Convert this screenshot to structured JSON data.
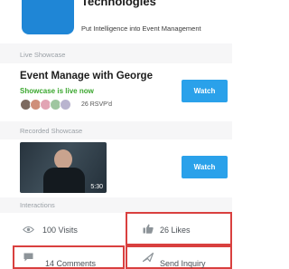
{
  "header": {
    "company_name": "Technologies",
    "tagline": "Put Intelligence into Event Management"
  },
  "live_showcase": {
    "label": "Live Showcase",
    "title": "Event Manage with George",
    "status": "Showcase is live now",
    "rsvp": "26 RSVP'd",
    "watch_label": "Watch"
  },
  "recorded_showcase": {
    "label": "Recorded Showcase",
    "duration": "5:30",
    "watch_label": "Watch"
  },
  "interactions": {
    "label": "Interactions",
    "visits": "100 Visits",
    "likes": "26 Likes",
    "comments": "14 Comments",
    "send_inquiry": "Send Inquiry"
  },
  "colors": {
    "accent": "#2aa1ea",
    "live_green": "#3ba72f",
    "highlight_red": "#d9403f",
    "logo_blue": "#1f86d6"
  },
  "icons": {
    "visits": "eye-icon",
    "likes": "thumbs-up-icon",
    "comments": "comment-icon",
    "send_inquiry": "send-icon"
  }
}
